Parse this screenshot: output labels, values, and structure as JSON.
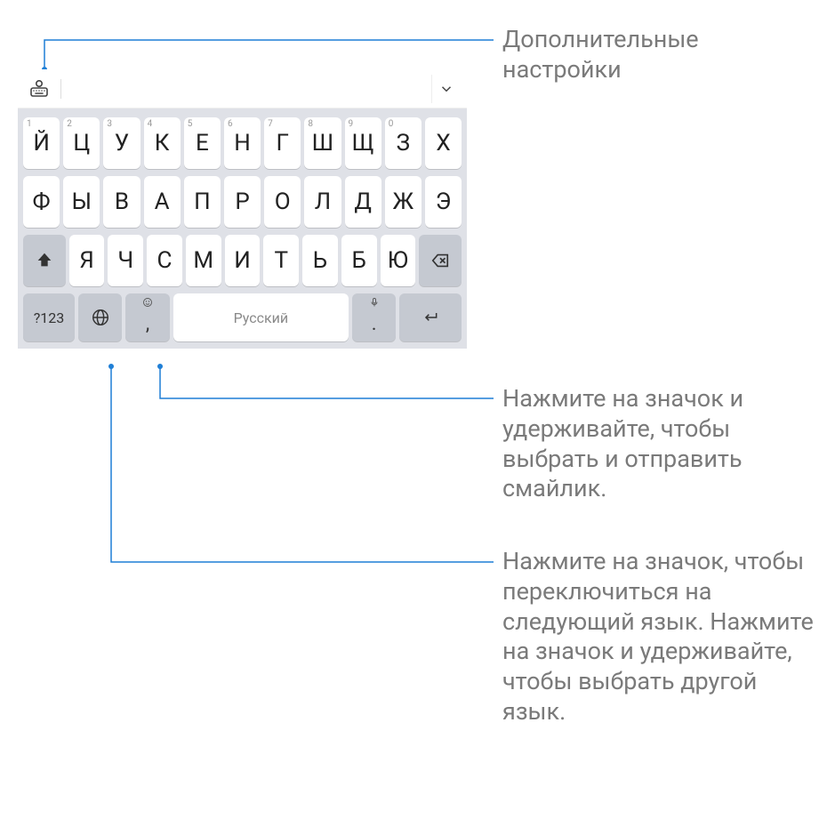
{
  "annotations": {
    "settings": "Дополнительные\nнастройки",
    "emoji": "Нажмите на значок и удерживайте, чтобы выбрать и отправить смайлик.",
    "language": "Нажмите на значок, чтобы переключиться на следующий язык. Нажмите на значок и удерживайте, чтобы выбрать другой язык."
  },
  "keyboard": {
    "row1": [
      {
        "label": "Й",
        "hint": "1"
      },
      {
        "label": "Ц",
        "hint": "2"
      },
      {
        "label": "У",
        "hint": "3"
      },
      {
        "label": "К",
        "hint": "4"
      },
      {
        "label": "Е",
        "hint": "5"
      },
      {
        "label": "Н",
        "hint": "6"
      },
      {
        "label": "Г",
        "hint": "7"
      },
      {
        "label": "Ш",
        "hint": "8"
      },
      {
        "label": "Щ",
        "hint": "9"
      },
      {
        "label": "З",
        "hint": "0"
      },
      {
        "label": "Х",
        "hint": ""
      }
    ],
    "row2": [
      {
        "label": "Ф"
      },
      {
        "label": "Ы"
      },
      {
        "label": "В"
      },
      {
        "label": "А"
      },
      {
        "label": "П"
      },
      {
        "label": "Р"
      },
      {
        "label": "О"
      },
      {
        "label": "Л"
      },
      {
        "label": "Д"
      },
      {
        "label": "Ж"
      },
      {
        "label": "Э"
      }
    ],
    "row3": [
      {
        "label": "Я"
      },
      {
        "label": "Ч"
      },
      {
        "label": "С"
      },
      {
        "label": "М"
      },
      {
        "label": "И"
      },
      {
        "label": "Т"
      },
      {
        "label": "Ь"
      },
      {
        "label": "Б"
      },
      {
        "label": "Ю"
      }
    ],
    "row4": {
      "symbols": "?123",
      "comma_main": ",",
      "comma_mini": "☺",
      "spacebar": "Русский",
      "dot_main": ".",
      "dot_mini": "mic"
    }
  },
  "icons": {
    "settings": "settings-keyboard",
    "collapse": "chevron-down",
    "shift": "shift",
    "backspace": "backspace",
    "globe": "globe",
    "enter": "enter",
    "mic": "mic",
    "smile": "smile"
  }
}
